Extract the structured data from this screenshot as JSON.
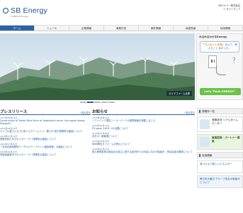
{
  "header": {
    "logo": "SB Energy",
    "logo_sub": "SoftBank Energy",
    "company": "SBエナジー株式会社",
    "sitemap": "＋ サイトマップ"
  },
  "nav": [
    {
      "label": "ホーム",
      "active": true
    },
    {
      "label": "ニュース"
    },
    {
      "label": "企業情報"
    },
    {
      "label": "事業内容"
    },
    {
      "label": "案件情報"
    },
    {
      "label": "地域貢献"
    },
    {
      "label": "採用情報"
    }
  ],
  "hero": {
    "caption": "ロイドファーム兵庫",
    "slides": 5,
    "active_slide": 1
  },
  "promo": {
    "title": "みるみるわかるEnergy",
    "bubble_prefix": "「コンセントの先」",
    "bubble_rest": "なんて、考えたことなかった。",
    "question": "？",
    "cta": "Let's Think ENERGY！"
  },
  "press": {
    "title": "プレスリリース",
    "more": "一覧を見る",
    "items": [
      {
        "date": "2018年08月13日",
        "text": "Construction of Tsetsii Wind Farm at Tsogttsetsii soum, Umnugobi aimag, Mongolia"
      },
      {
        "date": "2018年08月13日",
        "text": "モンゴル国ウムヌゴビ県ツォグトツェツィー郡での 風力発電所の建設について"
      },
      {
        "date": "2018年07月11日",
        "text": "長野県佐久市でのメガソーラー発電所の建設について"
      },
      {
        "date": "2018年07月05日",
        "text": "「半田法律事務所パーダルパワープラント建設事業」の建設について"
      },
      {
        "date": "2018年06月27日",
        "text": "茨城県麗原市でのメガソーラー発電所の建設について"
      }
    ]
  },
  "news": {
    "title": "お知らせ",
    "more": "一覧を見る",
    "items": [
      {
        "date": "2018年08月23日",
        "text": "ソフトバンク電柱ソーラーパークの発電実績を掲載しました"
      },
      {
        "date": "2018年08月13日",
        "text": "PV Japan 2018 への出展について"
      },
      {
        "date": "2018年07月06日",
        "text": "本日の一部報道について"
      },
      {
        "date": "2018年06月14日",
        "text": "WEB問合せフォームの停止について"
      },
      {
        "date": "2018年05月21日",
        "text": "風力発電事業の新会社の設立に関する各市町への対応に向けた取組み：岸谷区域の開発について"
      }
    ]
  },
  "side": {
    "power_title": "発電所一覧",
    "status": "発電状況 リアルタイムモニター",
    "partner": "事業提携・パートナー募集",
    "recruit_title": "採用情報",
    "banner1": "見つけよう新しいエネルギー",
    "banner2": "東日本大震災 グループ会社の取組みについて"
  }
}
